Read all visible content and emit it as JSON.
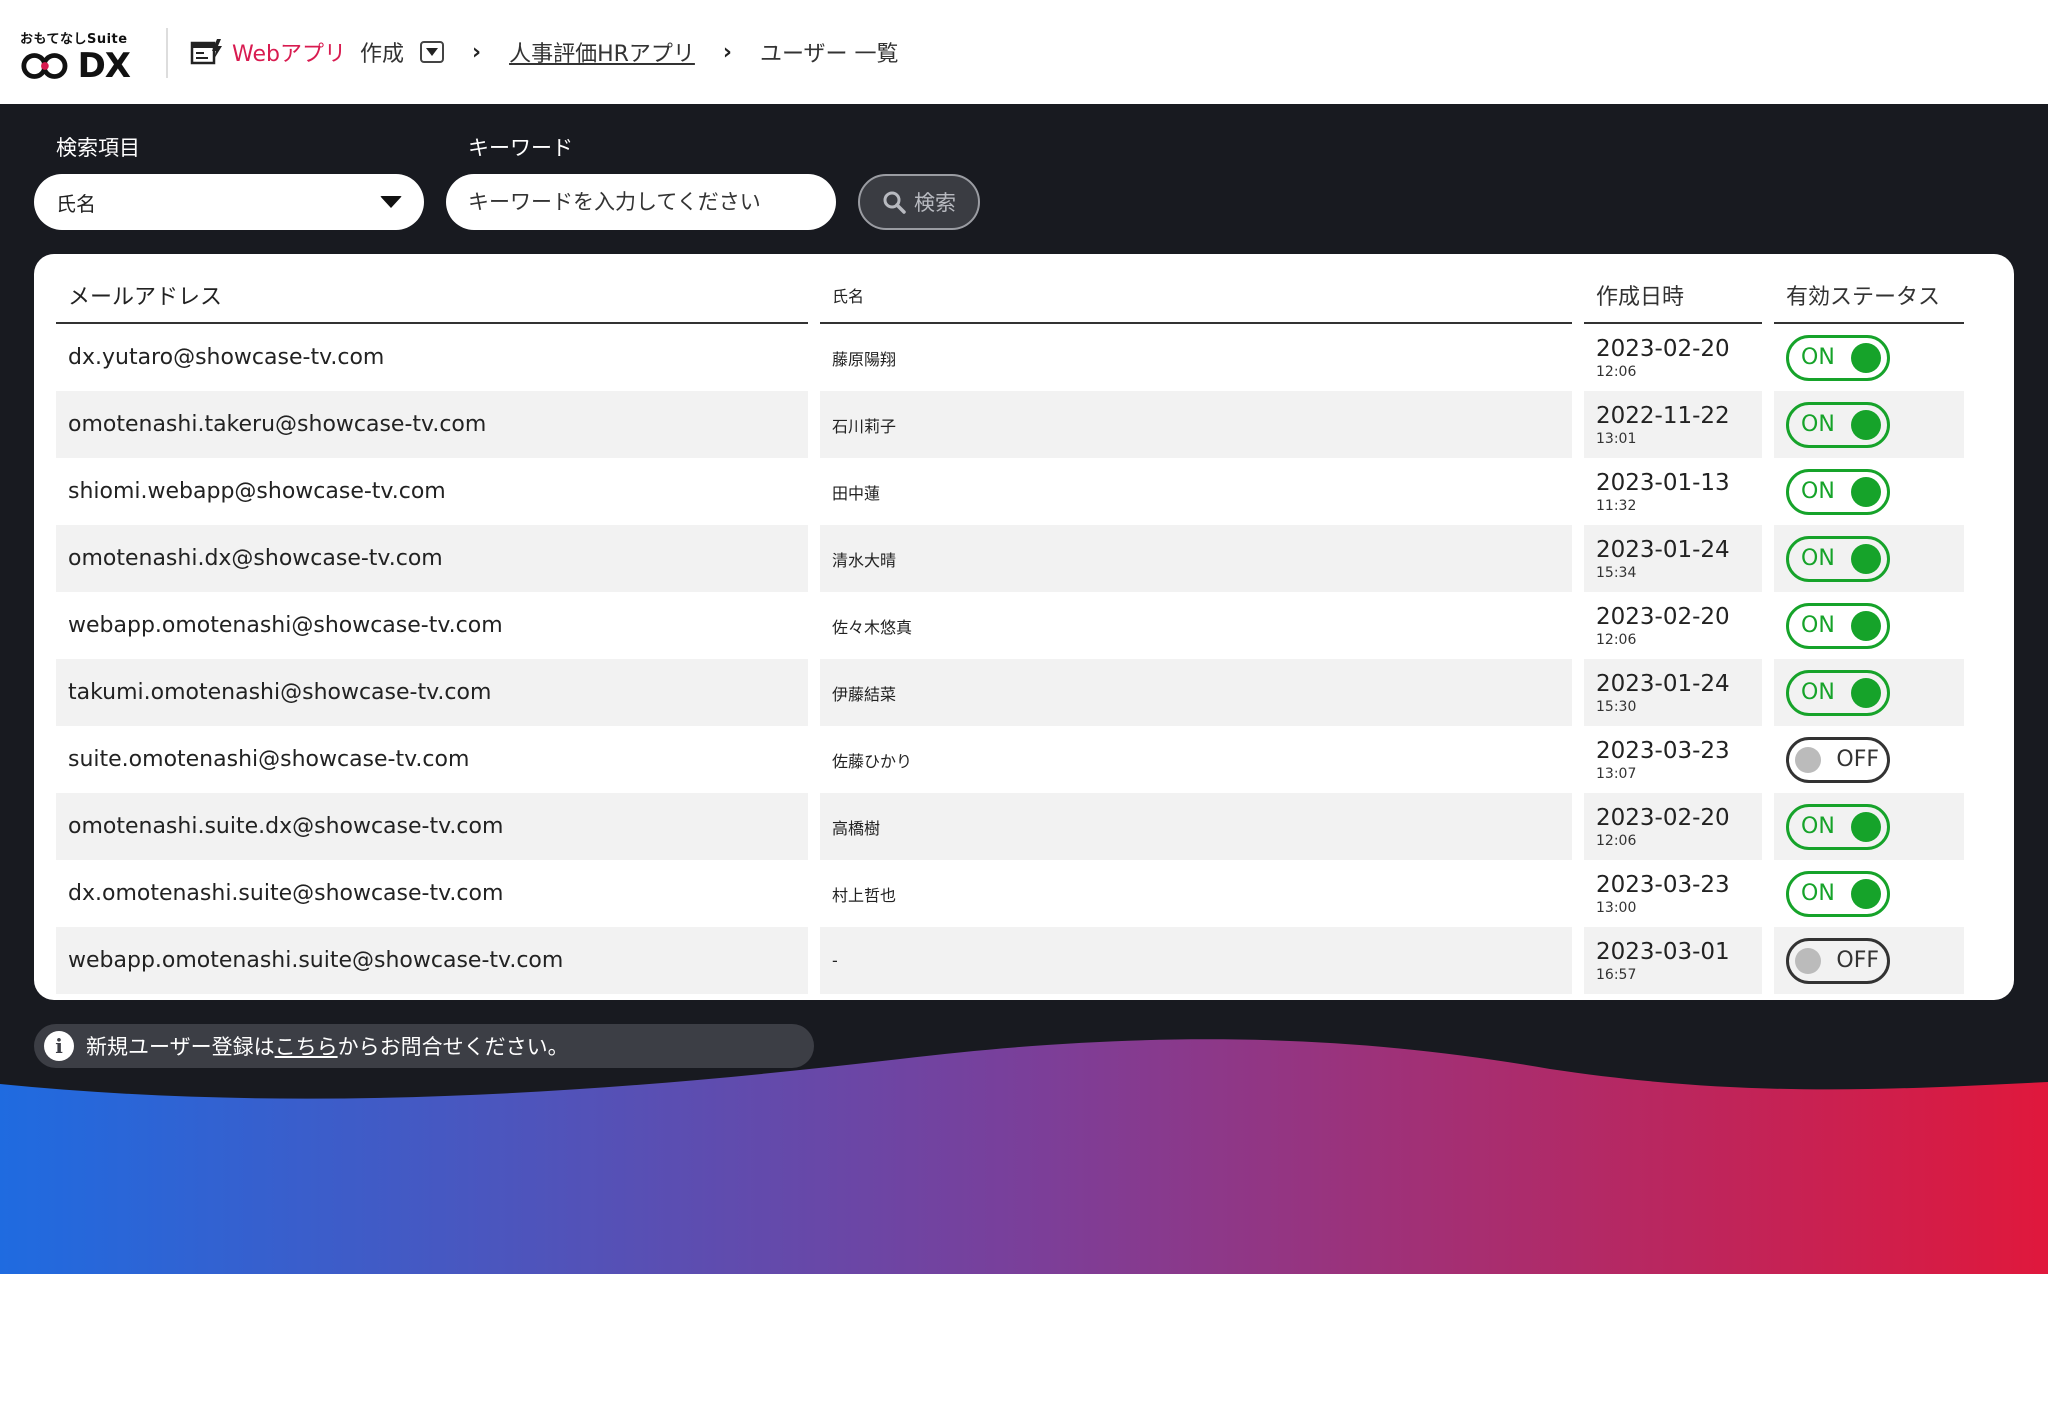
{
  "header": {
    "logo_top": "おもてなしSuite",
    "logo_dx": "DX",
    "crumb_web": "Webアプリ",
    "crumb_make": "作成",
    "crumb_app": "人事評価HRアプリ",
    "crumb_current": "ユーザー 一覧"
  },
  "search": {
    "field_label": "検索項目",
    "field_value": "氏名",
    "keyword_label": "キーワード",
    "keyword_placeholder": "キーワードを入力してください",
    "button_label": "検索"
  },
  "table": {
    "headers": [
      "メールアドレス",
      "氏名",
      "作成日時",
      "有効ステータス"
    ],
    "rows": [
      {
        "email": "dx.yutaro@showcase-tv.com",
        "name": "藤原陽翔",
        "date": "2023-02-20",
        "time": "12:06",
        "status": "ON"
      },
      {
        "email": "omotenashi.takeru@showcase-tv.com",
        "name": "石川莉子",
        "date": "2022-11-22",
        "time": "13:01",
        "status": "ON"
      },
      {
        "email": "shiomi.webapp@showcase-tv.com",
        "name": "田中蓮",
        "date": "2023-01-13",
        "time": "11:32",
        "status": "ON"
      },
      {
        "email": "omotenashi.dx@showcase-tv.com",
        "name": "清水大晴",
        "date": "2023-01-24",
        "time": "15:34",
        "status": "ON"
      },
      {
        "email": "webapp.omotenashi@showcase-tv.com",
        "name": "佐々木悠真",
        "date": "2023-02-20",
        "time": "12:06",
        "status": "ON"
      },
      {
        "email": "takumi.omotenashi@showcase-tv.com",
        "name": "伊藤結菜",
        "date": "2023-01-24",
        "time": "15:30",
        "status": "ON"
      },
      {
        "email": "suite.omotenashi@showcase-tv.com",
        "name": "佐藤ひかり",
        "date": "2023-03-23",
        "time": "13:07",
        "status": "OFF"
      },
      {
        "email": "omotenashi.suite.dx@showcase-tv.com",
        "name": "高橋樹",
        "date": "2023-02-20",
        "time": "12:06",
        "status": "ON"
      },
      {
        "email": "dx.omotenashi.suite@showcase-tv.com",
        "name": "村上哲也",
        "date": "2023-03-23",
        "time": "13:00",
        "status": "ON"
      },
      {
        "email": "webapp.omotenashi.suite@showcase-tv.com",
        "name": "-",
        "date": "2023-03-01",
        "time": "16:57",
        "status": "OFF"
      }
    ]
  },
  "notice": {
    "before": "新規ユーザー登録は",
    "link": "こちら",
    "after": "からお問合せください。"
  },
  "colors": {
    "accent": "#d81b50",
    "on": "#16a32a",
    "wave_left": "#1f6be0",
    "wave_right": "#e0183c"
  }
}
